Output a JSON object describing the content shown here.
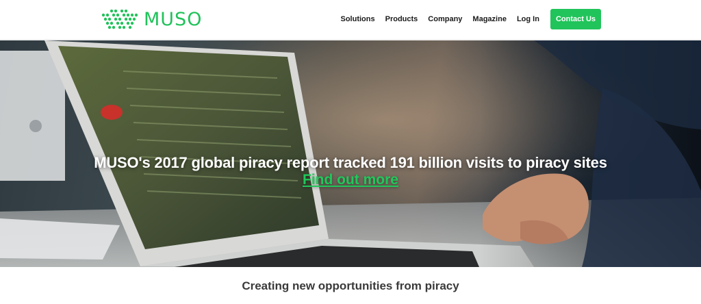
{
  "brand": {
    "name": "MUSO",
    "color": "#21c25a",
    "logo_icon": "dotted-wave-logo-icon"
  },
  "nav": {
    "items": [
      {
        "label": "Solutions"
      },
      {
        "label": "Products"
      },
      {
        "label": "Company"
      },
      {
        "label": "Magazine"
      },
      {
        "label": "Log In"
      }
    ],
    "cta_label": "Contact Us",
    "cta_color": "#20c45a"
  },
  "hero": {
    "headline": "MUSO's 2017 global piracy report tracked 191 billion visits to piracy sites",
    "link_label": "Find out more",
    "link_color": "#1fc85a",
    "background": "photo-laptop-hands-icon"
  },
  "section": {
    "title": "Creating new opportunities from piracy"
  }
}
